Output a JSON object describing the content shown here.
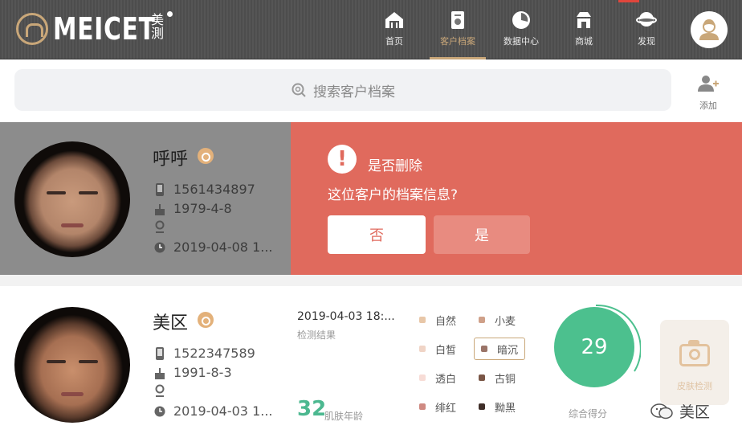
{
  "app": {
    "logo_text": "MEICET",
    "logo_cn": "美測"
  },
  "nav": [
    {
      "label": "首页",
      "icon": "home-icon"
    },
    {
      "label": "客户档案",
      "icon": "customer-file-icon",
      "active": true
    },
    {
      "label": "数据中心",
      "icon": "data-center-icon"
    },
    {
      "label": "商城",
      "icon": "mall-icon"
    },
    {
      "label": "发现",
      "icon": "discover-icon"
    }
  ],
  "search": {
    "placeholder": "搜索客户档案"
  },
  "add": {
    "label": "添加"
  },
  "customers": [
    {
      "name": "呼呼",
      "phone": "1561434897",
      "birthday": "1979-4-8",
      "location": "",
      "last_visit": "2019-04-08 1..."
    },
    {
      "name": "美区",
      "phone": "1522347589",
      "birthday": "1991-8-3",
      "location": "",
      "last_visit": "2019-04-03 1...",
      "detect_date": "2019-04-03 18:...",
      "detect_label": "检测结果",
      "skin_age": "32",
      "skin_age_label": "肌肤年龄",
      "score": "29",
      "score_label": "综合得分",
      "skin_test_label": "皮肤检测",
      "tones": [
        {
          "label": "自然",
          "color": "#e8c7a8"
        },
        {
          "label": "小麦",
          "color": "#cfa089"
        },
        {
          "label": "白皙",
          "color": "#f0d4c6"
        },
        {
          "label": "暗沉",
          "color": "#9a7468",
          "selected": true
        },
        {
          "label": "透白",
          "color": "#f7dcd6"
        },
        {
          "label": "古铜",
          "color": "#7a5646"
        },
        {
          "label": "绯红",
          "color": "#cf8a82"
        },
        {
          "label": "黝黑",
          "color": "#3f2e28"
        }
      ]
    }
  ],
  "delete_dialog": {
    "title": "是否删除",
    "message": "这位客户的档案信息?",
    "no": "否",
    "yes": "是"
  },
  "watermark": {
    "text": "美区"
  },
  "colors": {
    "accent_gold": "#c9a779",
    "dialog_red": "#e06a5d",
    "score_green": "#4cc08e"
  }
}
